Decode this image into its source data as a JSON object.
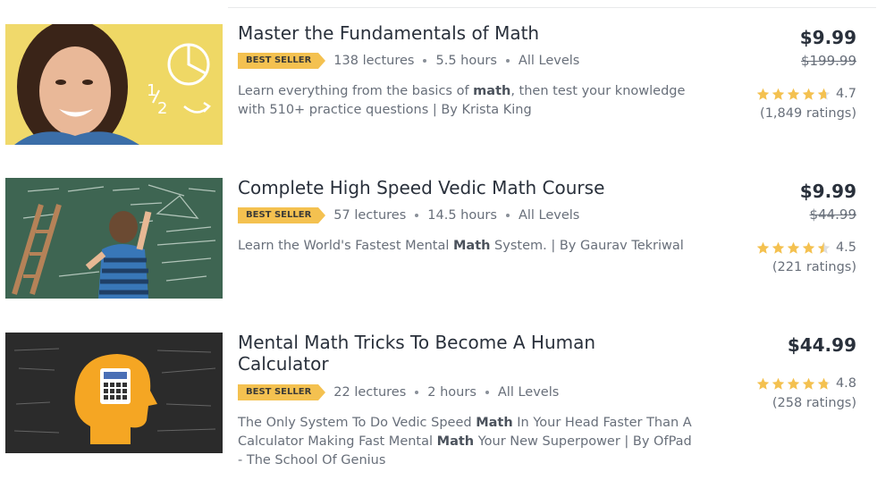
{
  "colors": {
    "badge": "#f4c150",
    "star": "#f4c150",
    "text": "#29303b",
    "muted": "#686f7a"
  },
  "courses": [
    {
      "title": "Master the Fundamentals of Math",
      "badge": "BEST SELLER",
      "lectures": "138 lectures",
      "hours": "5.5 hours",
      "level": "All Levels",
      "description": [
        [
          "Learn everything from the basics of ",
          false
        ],
        [
          "math",
          true
        ],
        [
          ", then test your knowledge with 510+ practice questions | By Krista King",
          false
        ]
      ],
      "price": "$9.99",
      "original_price": "$199.99",
      "rating": "4.7",
      "rating_stars": 4.7,
      "ratings_count": "(1,849 ratings)",
      "thumbnail": "woman-smiling-math-sketch"
    },
    {
      "title": "Complete High Speed Vedic Math Course",
      "badge": "BEST SELLER",
      "lectures": "57 lectures",
      "hours": "14.5 hours",
      "level": "All Levels",
      "description": [
        [
          "Learn the World's Fastest Mental ",
          false
        ],
        [
          "Math",
          true
        ],
        [
          " System. | By Gaurav Tekriwal",
          false
        ]
      ],
      "price": "$9.99",
      "original_price": "$44.99",
      "rating": "4.5",
      "rating_stars": 4.5,
      "ratings_count": "(221 ratings)",
      "thumbnail": "boy-at-chalkboard"
    },
    {
      "title": "Mental Math Tricks To Become A Human Calculator",
      "badge": "BEST SELLER",
      "lectures": "22 lectures",
      "hours": "2 hours",
      "level": "All Levels",
      "description": [
        [
          "The Only System To Do Vedic Speed ",
          false
        ],
        [
          "Math",
          true
        ],
        [
          " In Your Head Faster Than A Calculator Making Fast Mental ",
          false
        ],
        [
          "Math",
          true
        ],
        [
          " Your New Superpower | By OfPad - The School Of Genius",
          false
        ]
      ],
      "price": "$44.99",
      "original_price": "",
      "rating": "4.8",
      "rating_stars": 4.8,
      "ratings_count": "(258 ratings)",
      "thumbnail": "head-calculator-icon"
    }
  ]
}
